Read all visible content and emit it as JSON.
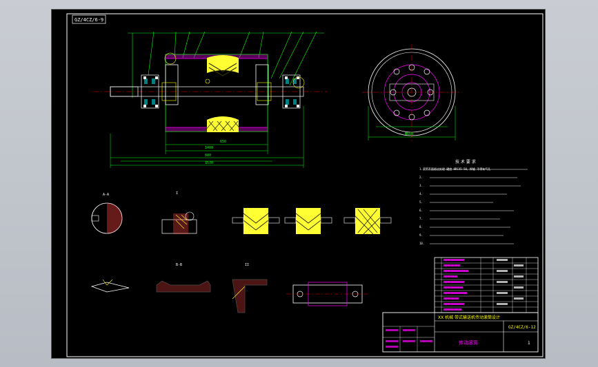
{
  "drawing": {
    "code_box": "GZ/4CZ/6-9",
    "tech_req_title": "技 术 要 求",
    "tech_req_lines": [
      "1.滚筒表面经过处理 硬度 HRC45-50，焊缝 不得有气孔",
      "2.",
      "3.",
      "4.",
      "5.",
      "6.",
      "7.",
      "8.",
      "9.",
      "10."
    ],
    "title_block": {
      "title_main": "XX 机械 带式输送机传动滚筒设计",
      "drawing_no": "GZ/4CZ/6-12",
      "drawing_name": "传动滚筒",
      "sheet": "1"
    },
    "detail_labels": {
      "section_a": "A-A",
      "section_b": "B-B",
      "detail_1": "I",
      "detail_2": "II"
    },
    "dims": {
      "overall": "1570",
      "body": "1400",
      "shaft": "800",
      "bore": "650",
      "diameter": "Φ650"
    }
  }
}
